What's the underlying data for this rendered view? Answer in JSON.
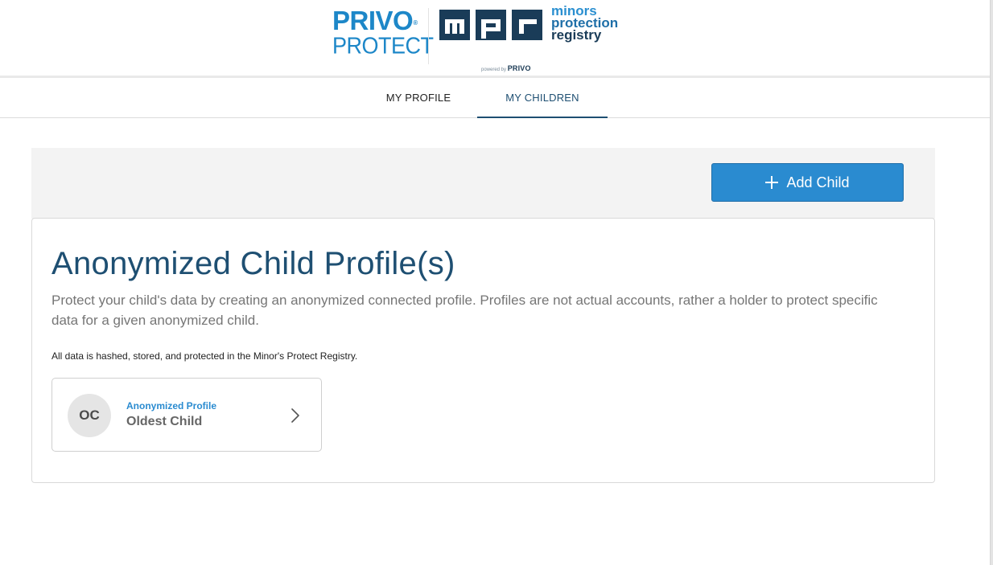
{
  "header": {
    "privo_logo": {
      "line1": "PRIVO",
      "registered": "®",
      "line2": "PROTECT"
    },
    "mpr_logo": {
      "mark_letters": "mpr",
      "line1": "minors",
      "line2": "protection",
      "line3": "registry",
      "powered_prefix": "powered by",
      "powered_brand": "PRIVO"
    }
  },
  "nav": {
    "tabs": [
      {
        "label": "MY PROFILE",
        "active": false
      },
      {
        "label": "MY CHILDREN",
        "active": true
      }
    ]
  },
  "toolbar": {
    "add_child_label": "Add Child",
    "add_child_icon": "plus-icon"
  },
  "section": {
    "title": "Anonymized Child Profile(s)",
    "description": "Protect your child's data by creating an anonymized connected profile. Profiles are not actual accounts, rather a holder to protect specific data for a given anonymized child.",
    "note": "All data is hashed, stored, and protected in the Minor's Protect Registry."
  },
  "profiles": [
    {
      "initials": "OC",
      "type": "Anonymized Profile",
      "name": "Oldest Child",
      "icon": "chevron-right-icon"
    }
  ],
  "colors": {
    "accent": "#2a8bd0",
    "heading": "#1e4f72",
    "toolbar_bg": "#f3f3f3"
  }
}
